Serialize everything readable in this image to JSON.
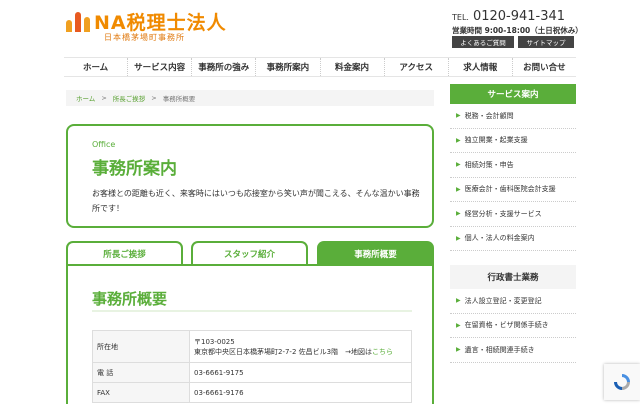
{
  "header": {
    "logo_text": "NA税理士法人",
    "logo_sub": "日本橋茅場町事務所",
    "tel_label": "TEL.",
    "tel_number": "0120-941-341",
    "hours": "営業時間 9:00-18:00（土日祝休み）",
    "faq_button": "よくあるご質問",
    "sitemap_button": "サイトマップ"
  },
  "nav": {
    "items": [
      "ホーム",
      "サービス内容",
      "事務所の強み",
      "事務所案内",
      "料金案内",
      "アクセス",
      "求人情報",
      "お問い合せ"
    ]
  },
  "breadcrumb": {
    "home": "ホーム",
    "sep": ">",
    "parent": "所長ご挨拶",
    "current": "事務所概要"
  },
  "office": {
    "label_en": "Office",
    "title": "事務所案内",
    "description": "お客様との距離も近く、来客時にはいつも応接室から笑い声が聞こえる、そんな温かい事務所です！"
  },
  "tabs": [
    {
      "label": "所長ご挨拶",
      "active": false
    },
    {
      "label": "スタッフ紹介",
      "active": false
    },
    {
      "label": "事務所概要",
      "active": true
    }
  ],
  "overview": {
    "title": "事務所概要",
    "rows": [
      {
        "label": "所在地",
        "postal": "〒103-0025",
        "address": "東京都中央区日本橋茅場町2-7-2 佐昌ビル3階　→地図は",
        "map_link": "こちら"
      },
      {
        "label": "電 話",
        "value": "03-6661-9175"
      },
      {
        "label": "FAX",
        "value": "03-6661-9176"
      }
    ]
  },
  "sidebar": {
    "services_heading": "サービス案内",
    "services": [
      "税務・会計顧問",
      "独立開業・起業支援",
      "相続対策・申告",
      "医療会計・歯科医院会計支援",
      "経営分析・支援サービス",
      "個人・法人の料金案内"
    ],
    "gyosei_heading": "行政書士業務",
    "gyosei": [
      "法人設立登記・変更登記",
      "在留資格・ビザ関係手続き",
      "遺言・相続関連手続き"
    ]
  },
  "colors": {
    "accent": "#5aae3a",
    "logo": "#f08a00"
  }
}
